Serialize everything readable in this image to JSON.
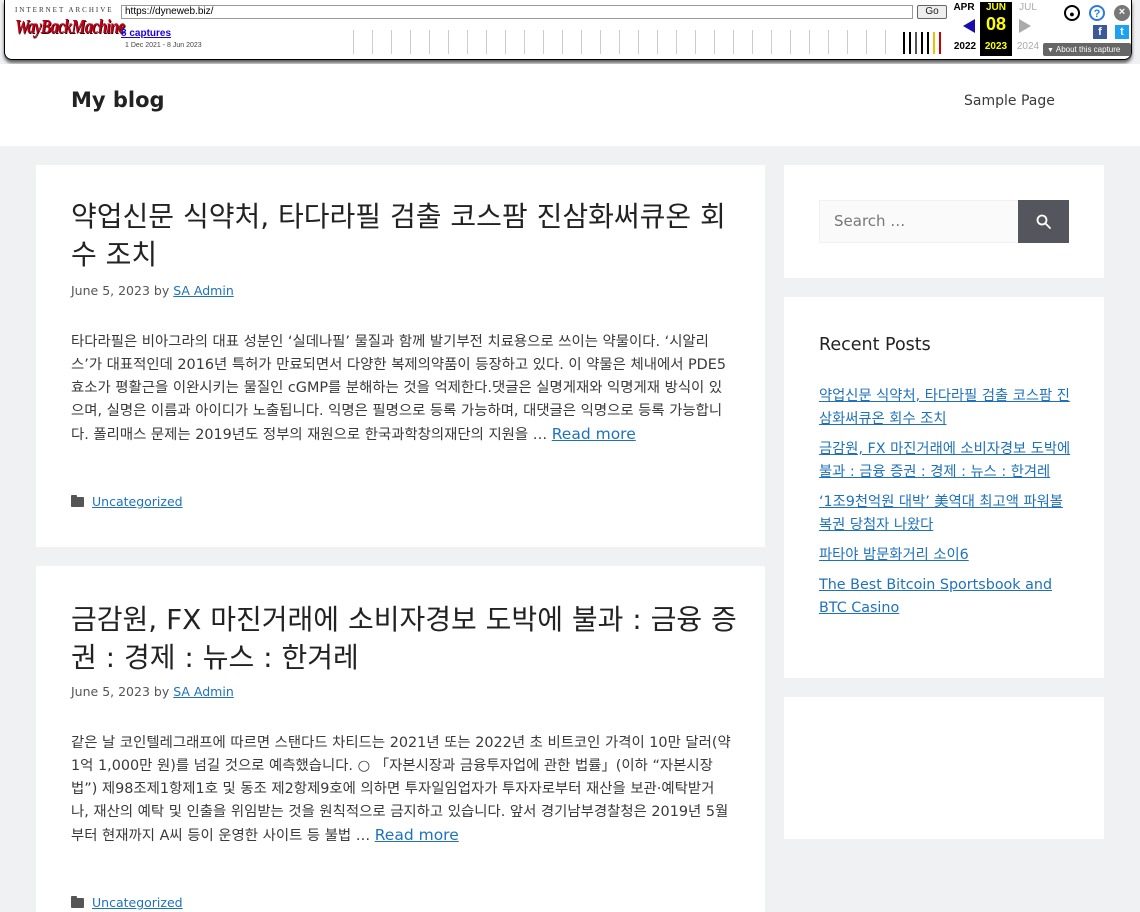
{
  "wayback": {
    "logo_top": "INTERNET ARCHIVE",
    "logo_main": "WayBackMachine",
    "url": "https://dyneweb.biz/",
    "go_label": "Go",
    "captures": "8 captures",
    "date_range": "1 Dec 2021 - 8 Jun 2023",
    "months": [
      "APR",
      "JUN",
      "JUL"
    ],
    "day": "08",
    "years": [
      "2022",
      "2023",
      "2024"
    ],
    "about": "About this capture",
    "highlight_color": "#ffff00"
  },
  "header": {
    "site_title": "My blog",
    "nav": [
      "Sample Page"
    ]
  },
  "posts": [
    {
      "title": "약업신문 식약처, 타다라필 검출 코스팜 진삼화써큐온 회수 조치",
      "date": "June 5, 2023",
      "by": "by",
      "author": "SA Admin",
      "excerpt": "타다라필은 비아그라의 대표 성분인 ‘실데나필’ 물질과 함께 발기부전 치료용으로 쓰이는 약물이다. ‘시알리스’가 대표적인데 2016년 특허가 만료되면서 다양한 복제의약품이 등장하고 있다. 이 약물은 체내에서 PDE5 효소가 평활근을 이완시키는 물질인 cGMP를 분해하는 것을 억제한다.댓글은 실명게재와 익명게재 방식이 있으며, 실명은 이름과 아이디가 노출됩니다. 익명은 필명으로 등록 가능하며, 대댓글은 익명으로 등록 가능합니다. 폴리매스 문제는 2019년도 정부의 재원으로 한국과학창의재단의 지원을 …",
      "read_more": "Read more",
      "category": "Uncategorized"
    },
    {
      "title": "금감원, FX 마진거래에 소비자경보 도박에 불과 : 금융 증권 : 경제 : 뉴스 : 한겨레",
      "date": "June 5, 2023",
      "by": "by",
      "author": "SA Admin",
      "excerpt": "같은 날 코인텔레그래프에 따르면 스탠다드 차티드는 2021년 또는 2022년 초 비트코인 가격이 10만 달러(약 1억 1,000만 원)를 넘길 것으로 예측했습니다. ○ 「자본시장과 금융투자업에 관한 법률」(이하 “자본시장법”) 제98조제1항제1호 및 동조 제2항제9호에 의하면 투자일임업자가 투자자로부터 재산을 보관·예탁받거나, 재산의 예탁 및 인출을 위임받는 것을 원칙적으로 금지하고 있습니다. 앞서 경기남부경찰청은 2019년 5월부터 현재까지 A씨 등이 운영한 사이트 등 불법 …",
      "read_more": "Read more",
      "category": "Uncategorized"
    }
  ],
  "sidebar": {
    "search_placeholder": "Search …",
    "recent_title": "Recent Posts",
    "recent": [
      "약업신문 식약처, 타다라필 검출 코스팜 진삼화써큐온 회수 조치",
      "금감원, FX 마진거래에 소비자경보 도박에 불과 : 금융 증권 : 경제 : 뉴스 : 한겨레",
      "‘1조9천억원 대박’ 美역대 최고액 파워볼 복권 당첨자 나왔다",
      "파타야 밤문화거리 소이6",
      "The Best Bitcoin Sportsbook and BTC Casino"
    ]
  }
}
